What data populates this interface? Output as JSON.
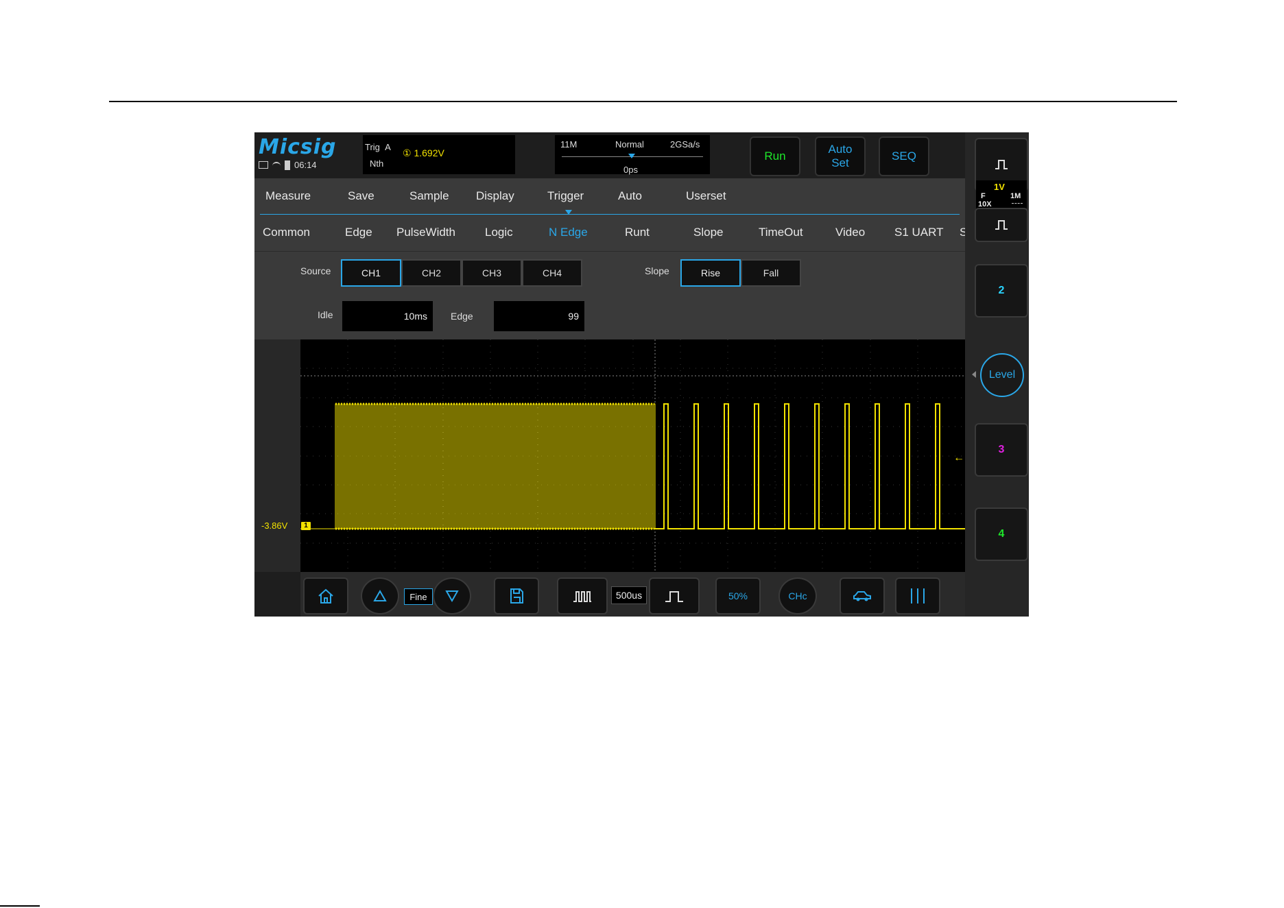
{
  "colors": {
    "accent": "#2aa7e8",
    "ch1": "#f2e200",
    "ch2": "#2ad4ff",
    "ch3": "#e020e0",
    "ch4": "#1ee82a",
    "run": "#1ee82a"
  },
  "brand": {
    "logo": "Micsig"
  },
  "status": {
    "time": "06:14",
    "icons": [
      "monitor-icon",
      "wifi-icon",
      "battery-icon"
    ]
  },
  "trigger_info": {
    "label": "Trig",
    "source": "A",
    "sub": "Nth",
    "level": "① 1.692V"
  },
  "timebase_info": {
    "memory": "11M",
    "mode": "Normal",
    "sample_rate": "2GSa/s",
    "position": "0ps"
  },
  "top_buttons": {
    "run": "Run",
    "auto_set_line1": "Auto",
    "auto_set_line2": "Set",
    "seq": "SEQ"
  },
  "menu": {
    "tabs": [
      "Measure",
      "Save",
      "Sample",
      "Display",
      "Trigger",
      "Auto",
      "Userset"
    ],
    "active_tab": "Trigger"
  },
  "trigger_types": {
    "items": [
      "Common",
      "Edge",
      "PulseWidth",
      "Logic",
      "N Edge",
      "Runt",
      "Slope",
      "TimeOut",
      "Video",
      "S1 UART",
      "S"
    ],
    "active": "N Edge"
  },
  "nedge_settings": {
    "source_label": "Source",
    "sources": [
      "CH1",
      "CH2",
      "CH3",
      "CH4"
    ],
    "selected_source": "CH1",
    "slope_label": "Slope",
    "slopes": [
      "Rise",
      "Fall"
    ],
    "selected_slope": "Rise",
    "idle_label": "Idle",
    "idle_value": "10ms",
    "edge_label": "Edge",
    "edge_value": "99"
  },
  "waveform": {
    "ch1_offset": "-3.86V",
    "ch1_marker": "1"
  },
  "bottom_bar": {
    "fine_label": "Fine",
    "timebase": "500us",
    "fifty_percent": "50%",
    "chc": "CHc",
    "icons": [
      "home-icon",
      "up-triangle-icon",
      "down-triangle-icon",
      "save-icon",
      "zoom-out-pulse-icon",
      "zoom-in-pulse-icon",
      "car-icon",
      "cursor-bars-icon"
    ]
  },
  "channels": {
    "ch1_scale": "1V",
    "ch1_coupling": "F",
    "ch1_probe": "10X",
    "ch1_impedance": "1M",
    "ch2": "2",
    "ch3": "3",
    "ch4": "4",
    "level": "Level"
  }
}
